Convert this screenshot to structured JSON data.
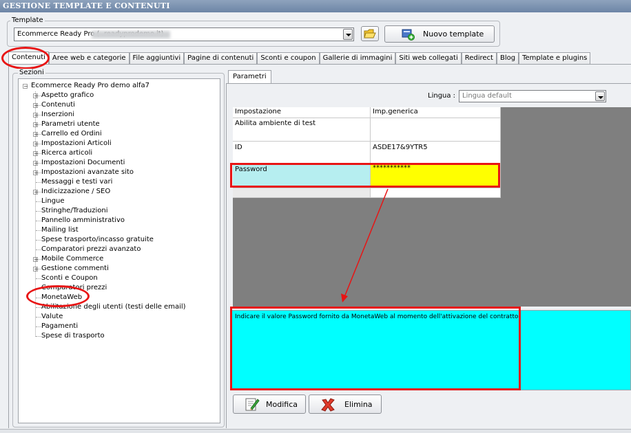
{
  "window": {
    "title": "GESTIONE TEMPLATE E CONTENUTI"
  },
  "template_group": {
    "label": "Template",
    "selected_value": "Ecommerce Ready Pro (                    .readyprodemo.it)",
    "new_template_label": "Nuovo template"
  },
  "tabs": [
    {
      "label": "Contenuti",
      "active": true
    },
    {
      "label": "Aree web e categorie"
    },
    {
      "label": "File aggiuntivi"
    },
    {
      "label": "Pagine di contenuti"
    },
    {
      "label": "Sconti e coupon"
    },
    {
      "label": "Gallerie di immagini"
    },
    {
      "label": "Siti web collegati"
    },
    {
      "label": "Redirect"
    },
    {
      "label": "Blog"
    },
    {
      "label": "Template e plugins"
    }
  ],
  "sections": {
    "label": "Sezioni",
    "root": "Ecommerce Ready Pro demo alfa7",
    "items": [
      {
        "label": "Aspetto grafico",
        "expandable": true
      },
      {
        "label": "Contenuti",
        "expandable": true
      },
      {
        "label": "Inserzioni",
        "expandable": true
      },
      {
        "label": "Parametri utente",
        "expandable": true
      },
      {
        "label": "Carrello ed Ordini",
        "expandable": true
      },
      {
        "label": "Impostazioni Articoli",
        "expandable": true
      },
      {
        "label": "Ricerca articoli",
        "expandable": true
      },
      {
        "label": "Impostazioni Documenti",
        "expandable": true
      },
      {
        "label": "Impostazioni avanzate sito",
        "expandable": true
      },
      {
        "label": "Messaggi e testi vari",
        "expandable": false
      },
      {
        "label": "Indicizzazione / SEO",
        "expandable": true
      },
      {
        "label": "Lingue",
        "expandable": false
      },
      {
        "label": "Stringhe/Traduzioni",
        "expandable": false
      },
      {
        "label": "Pannello amministrativo",
        "expandable": false
      },
      {
        "label": "Mailing list",
        "expandable": false
      },
      {
        "label": "Spese trasporto/incasso gratuite",
        "expandable": false
      },
      {
        "label": "Comparatori prezzi avanzato",
        "expandable": false
      },
      {
        "label": "Mobile Commerce",
        "expandable": true
      },
      {
        "label": "Gestione commenti",
        "expandable": true
      },
      {
        "label": "Sconti e Coupon",
        "expandable": false
      },
      {
        "label": "Comparatori prezzi",
        "expandable": false
      },
      {
        "label": "MonetaWeb",
        "expandable": false,
        "selected": true
      },
      {
        "label": "Abilitazione degli utenti (testi delle email)",
        "expandable": false
      },
      {
        "label": "Valute",
        "expandable": false
      },
      {
        "label": "Pagamenti",
        "expandable": false
      },
      {
        "label": "Spese di trasporto",
        "expandable": false
      }
    ]
  },
  "params": {
    "tab_label": "Parametri",
    "language_label": "Lingua :",
    "language_value": "Lingua default",
    "columns": [
      "Impostazione",
      "Imp.generica"
    ],
    "rows": [
      {
        "setting": "Abilita ambiente di test",
        "value": ""
      },
      {
        "setting": "ID",
        "value": "ASDE17&9YTR5"
      },
      {
        "setting": "Password",
        "value": "***********"
      }
    ],
    "description": "Indicare il valore Password fornito da MonetaWeb al momento dell'attivazione del contratto"
  },
  "actions": {
    "edit_label": "Modifica",
    "delete_label": "Elimina"
  },
  "colors": {
    "highlight_red": "#e81414",
    "description_bg": "#00ffff",
    "password_value_bg": "#ffff00",
    "password_label_bg": "#b6eef0"
  }
}
